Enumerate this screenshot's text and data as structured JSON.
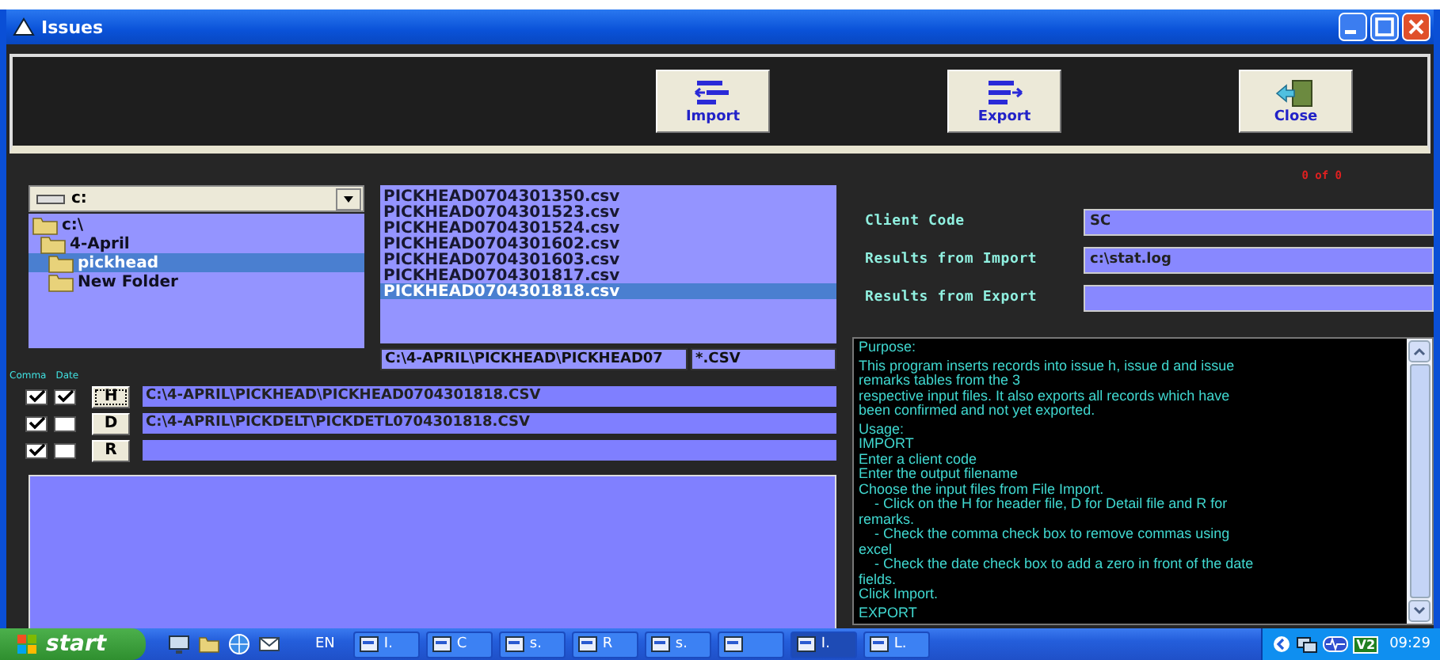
{
  "window": {
    "title": "Issues"
  },
  "toolbar": [
    {
      "kind": "import",
      "label": "Import"
    },
    {
      "kind": "export",
      "label": "Export"
    },
    {
      "kind": "close",
      "label": "Close"
    }
  ],
  "drive_combo": {
    "value": "c:"
  },
  "folders": [
    {
      "name": "c:\\",
      "selected": false,
      "children": [
        {
          "name": "4-April",
          "selected": false,
          "children": [
            {
              "name": "pickhead",
              "selected": true
            },
            {
              "name": "New Folder",
              "selected": false
            }
          ]
        }
      ]
    }
  ],
  "files": [
    {
      "name": "PICKHEAD0704301350.csv",
      "selected": false
    },
    {
      "name": "PICKHEAD0704301523.csv",
      "selected": false
    },
    {
      "name": "PICKHEAD0704301524.csv",
      "selected": false
    },
    {
      "name": "PICKHEAD0704301602.csv",
      "selected": false
    },
    {
      "name": "PICKHEAD0704301603.csv",
      "selected": false
    },
    {
      "name": "PICKHEAD0704301817.csv",
      "selected": false
    },
    {
      "name": "PICKHEAD0704301818.csv",
      "selected": true
    }
  ],
  "path_field": {
    "value": "C:\\4-APRIL\\PICKHEAD\\PICKHEAD07"
  },
  "pattern_field": {
    "value": "*.CSV"
  },
  "counter": "0 of 0",
  "form": [
    {
      "label": "Client Code",
      "value": "SC"
    },
    {
      "label": "Results from Import",
      "value": "c:\\stat.log"
    },
    {
      "label": "Results from Export"
    }
  ],
  "import_headings": [
    "Comma",
    "Date"
  ],
  "import_rows": [
    {
      "comma": true,
      "date": true,
      "button": "H",
      "focused": true,
      "path": "C:\\4-APRIL\\PICKHEAD\\PICKHEAD0704301818.CSV"
    },
    {
      "comma": true,
      "date": false,
      "button": "D",
      "focused": false,
      "path": "C:\\4-APRIL\\PICKDELT\\PICKDETL0704301818.CSV"
    },
    {
      "comma": true,
      "date": false,
      "button": "R",
      "focused": false
    }
  ],
  "purpose": [
    [
      "Purpose:"
    ],
    [
      "This program inserts records into issue h, issue d and issue",
      "remarks tables from the 3",
      "respective input files. It also exports all records which have",
      "been confirmed and not yet exported."
    ],
    [
      "Usage:",
      "IMPORT",
      "Enter a client code",
      "Enter the output filename",
      "Choose the input files from File Import.",
      "    - Click on the H for header file, D for Detail file and R for",
      "remarks.",
      "    - Check the comma check box to remove commas using",
      "excel",
      "    - Check the date check box to add a zero in front of the date",
      "fields.",
      "Click Import."
    ],
    [
      "EXPORT"
    ]
  ],
  "taskbar": {
    "start": "start",
    "language": "EN",
    "tasks": [
      {
        "label": "I.",
        "selected": false
      },
      {
        "label": "C",
        "selected": false
      },
      {
        "label": "s.",
        "selected": false
      },
      {
        "label": "R",
        "selected": false
      },
      {
        "label": "s.",
        "selected": false
      },
      {
        "selected": false
      },
      {
        "label": "I.",
        "selected": true
      },
      {
        "label": "L.",
        "selected": false
      }
    ],
    "tray_label": "V2",
    "clock": "09:29"
  }
}
